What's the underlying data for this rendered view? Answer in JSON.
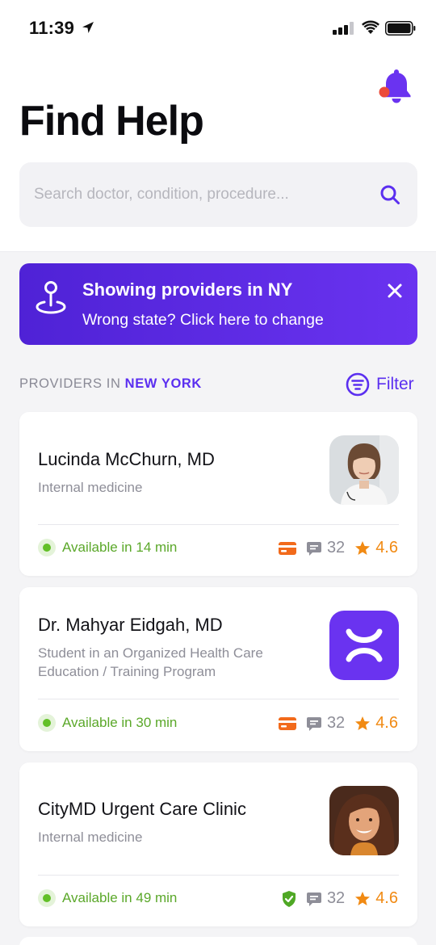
{
  "status_bar": {
    "time": "11:39"
  },
  "header": {
    "title": "Find Help",
    "search_placeholder": "Search doctor, condition, procedure..."
  },
  "banner": {
    "title": "Showing providers in NY",
    "subtitle": "Wrong state? Click here to change"
  },
  "section": {
    "prefix": "PROVIDERS IN",
    "state": "NEW YORK",
    "filter_label": "Filter"
  },
  "providers": [
    {
      "name": "Lucinda McChurn, MD",
      "specialty": "Internal medicine",
      "availability": "Available in 14 min",
      "badge_icon": "credit-card-icon",
      "reviews": "32",
      "rating": "4.6"
    },
    {
      "name": "Dr. Mahyar Eidgah, MD",
      "specialty": "Student in an Organized Health Care Education / Training Program",
      "availability": "Available in 30 min",
      "badge_icon": "credit-card-icon",
      "reviews": "32",
      "rating": "4.6"
    },
    {
      "name": "CityMD Urgent Care Clinic",
      "specialty": "Internal medicine",
      "availability": "Available in 49 min",
      "badge_icon": "shield-check-icon",
      "reviews": "32",
      "rating": "4.6"
    }
  ],
  "colors": {
    "accent": "#5b2ff0",
    "available": "#62c027",
    "rating": "#f18a13",
    "card_badge": "#f26a1b",
    "notification_dot": "#ec4b3a"
  }
}
